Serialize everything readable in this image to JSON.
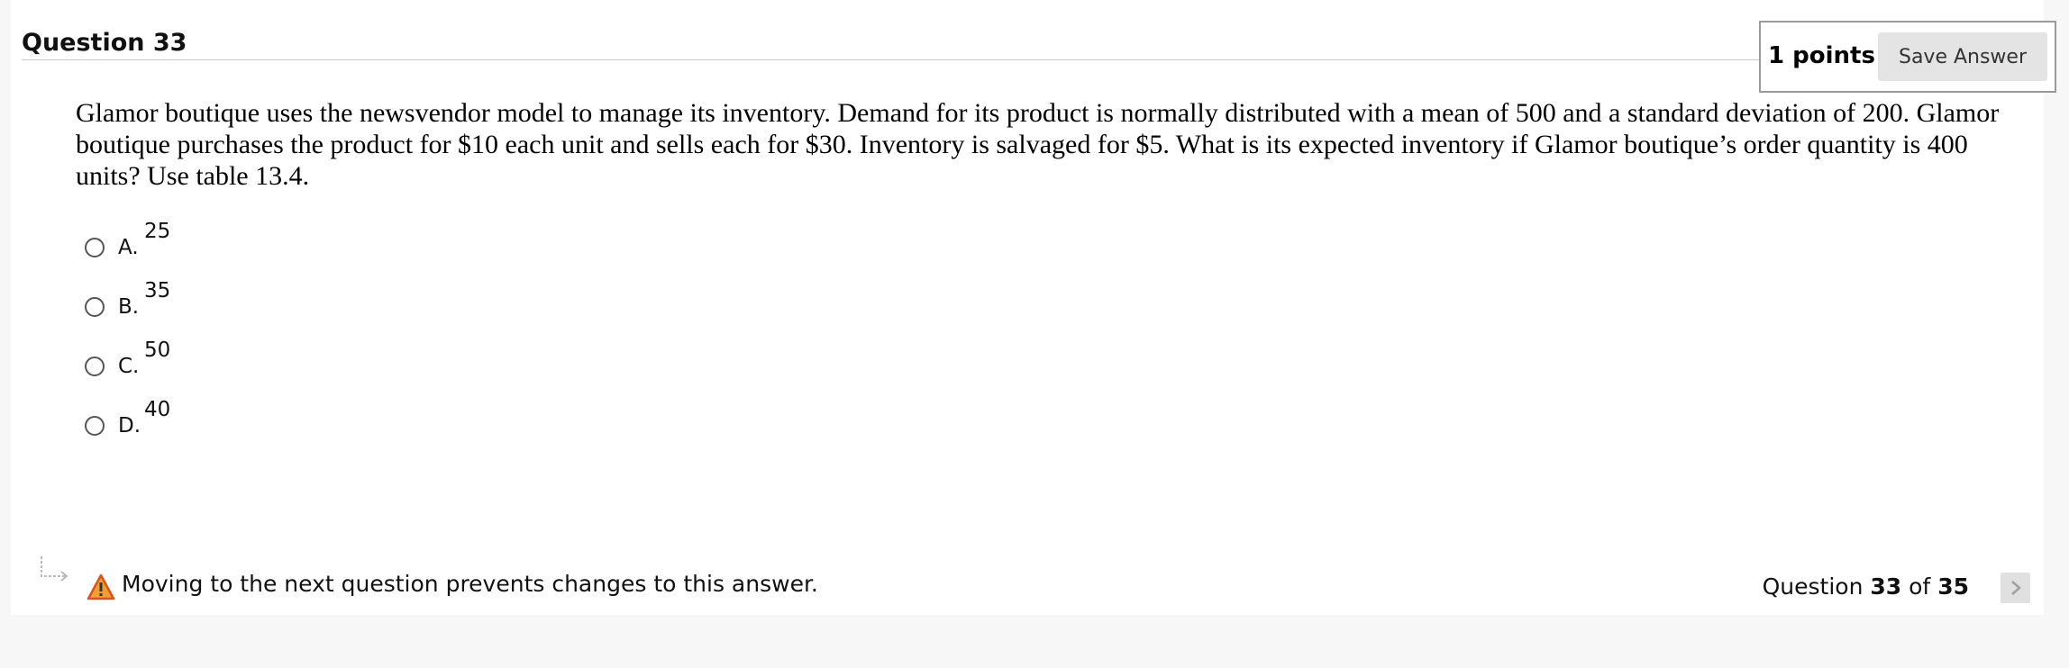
{
  "question": {
    "title": "Question 33",
    "points": "1 points",
    "save_label": "Save Answer",
    "text": "Glamor boutique uses the newsvendor model to manage its inventory. Demand for its product is normally distributed with a mean of 500 and a standard deviation of 200. Glamor boutique purchases the product for $10 each unit and sells each for $30. Inventory is salvaged for $5. What is its expected inventory if Glamor boutique’s order quantity is 400 units? Use table 13.4.",
    "choices": [
      {
        "letter": "A.",
        "value": "25"
      },
      {
        "letter": "B.",
        "value": "35"
      },
      {
        "letter": "C.",
        "value": "50"
      },
      {
        "letter": "D.",
        "value": "40"
      }
    ]
  },
  "footer": {
    "warning": "Moving to the next question prevents changes to this answer.",
    "pager_prefix": "Question",
    "current": "33",
    "of_word": "of",
    "total": "35"
  },
  "icons": {
    "warning": "warning-triangle-icon",
    "arrow": "return-arrow-icon",
    "next": "chevron-right-icon"
  },
  "colors": {
    "warning_fill": "#f0a030",
    "warning_border": "#d9531e",
    "button_bg": "#e4e4e4"
  }
}
